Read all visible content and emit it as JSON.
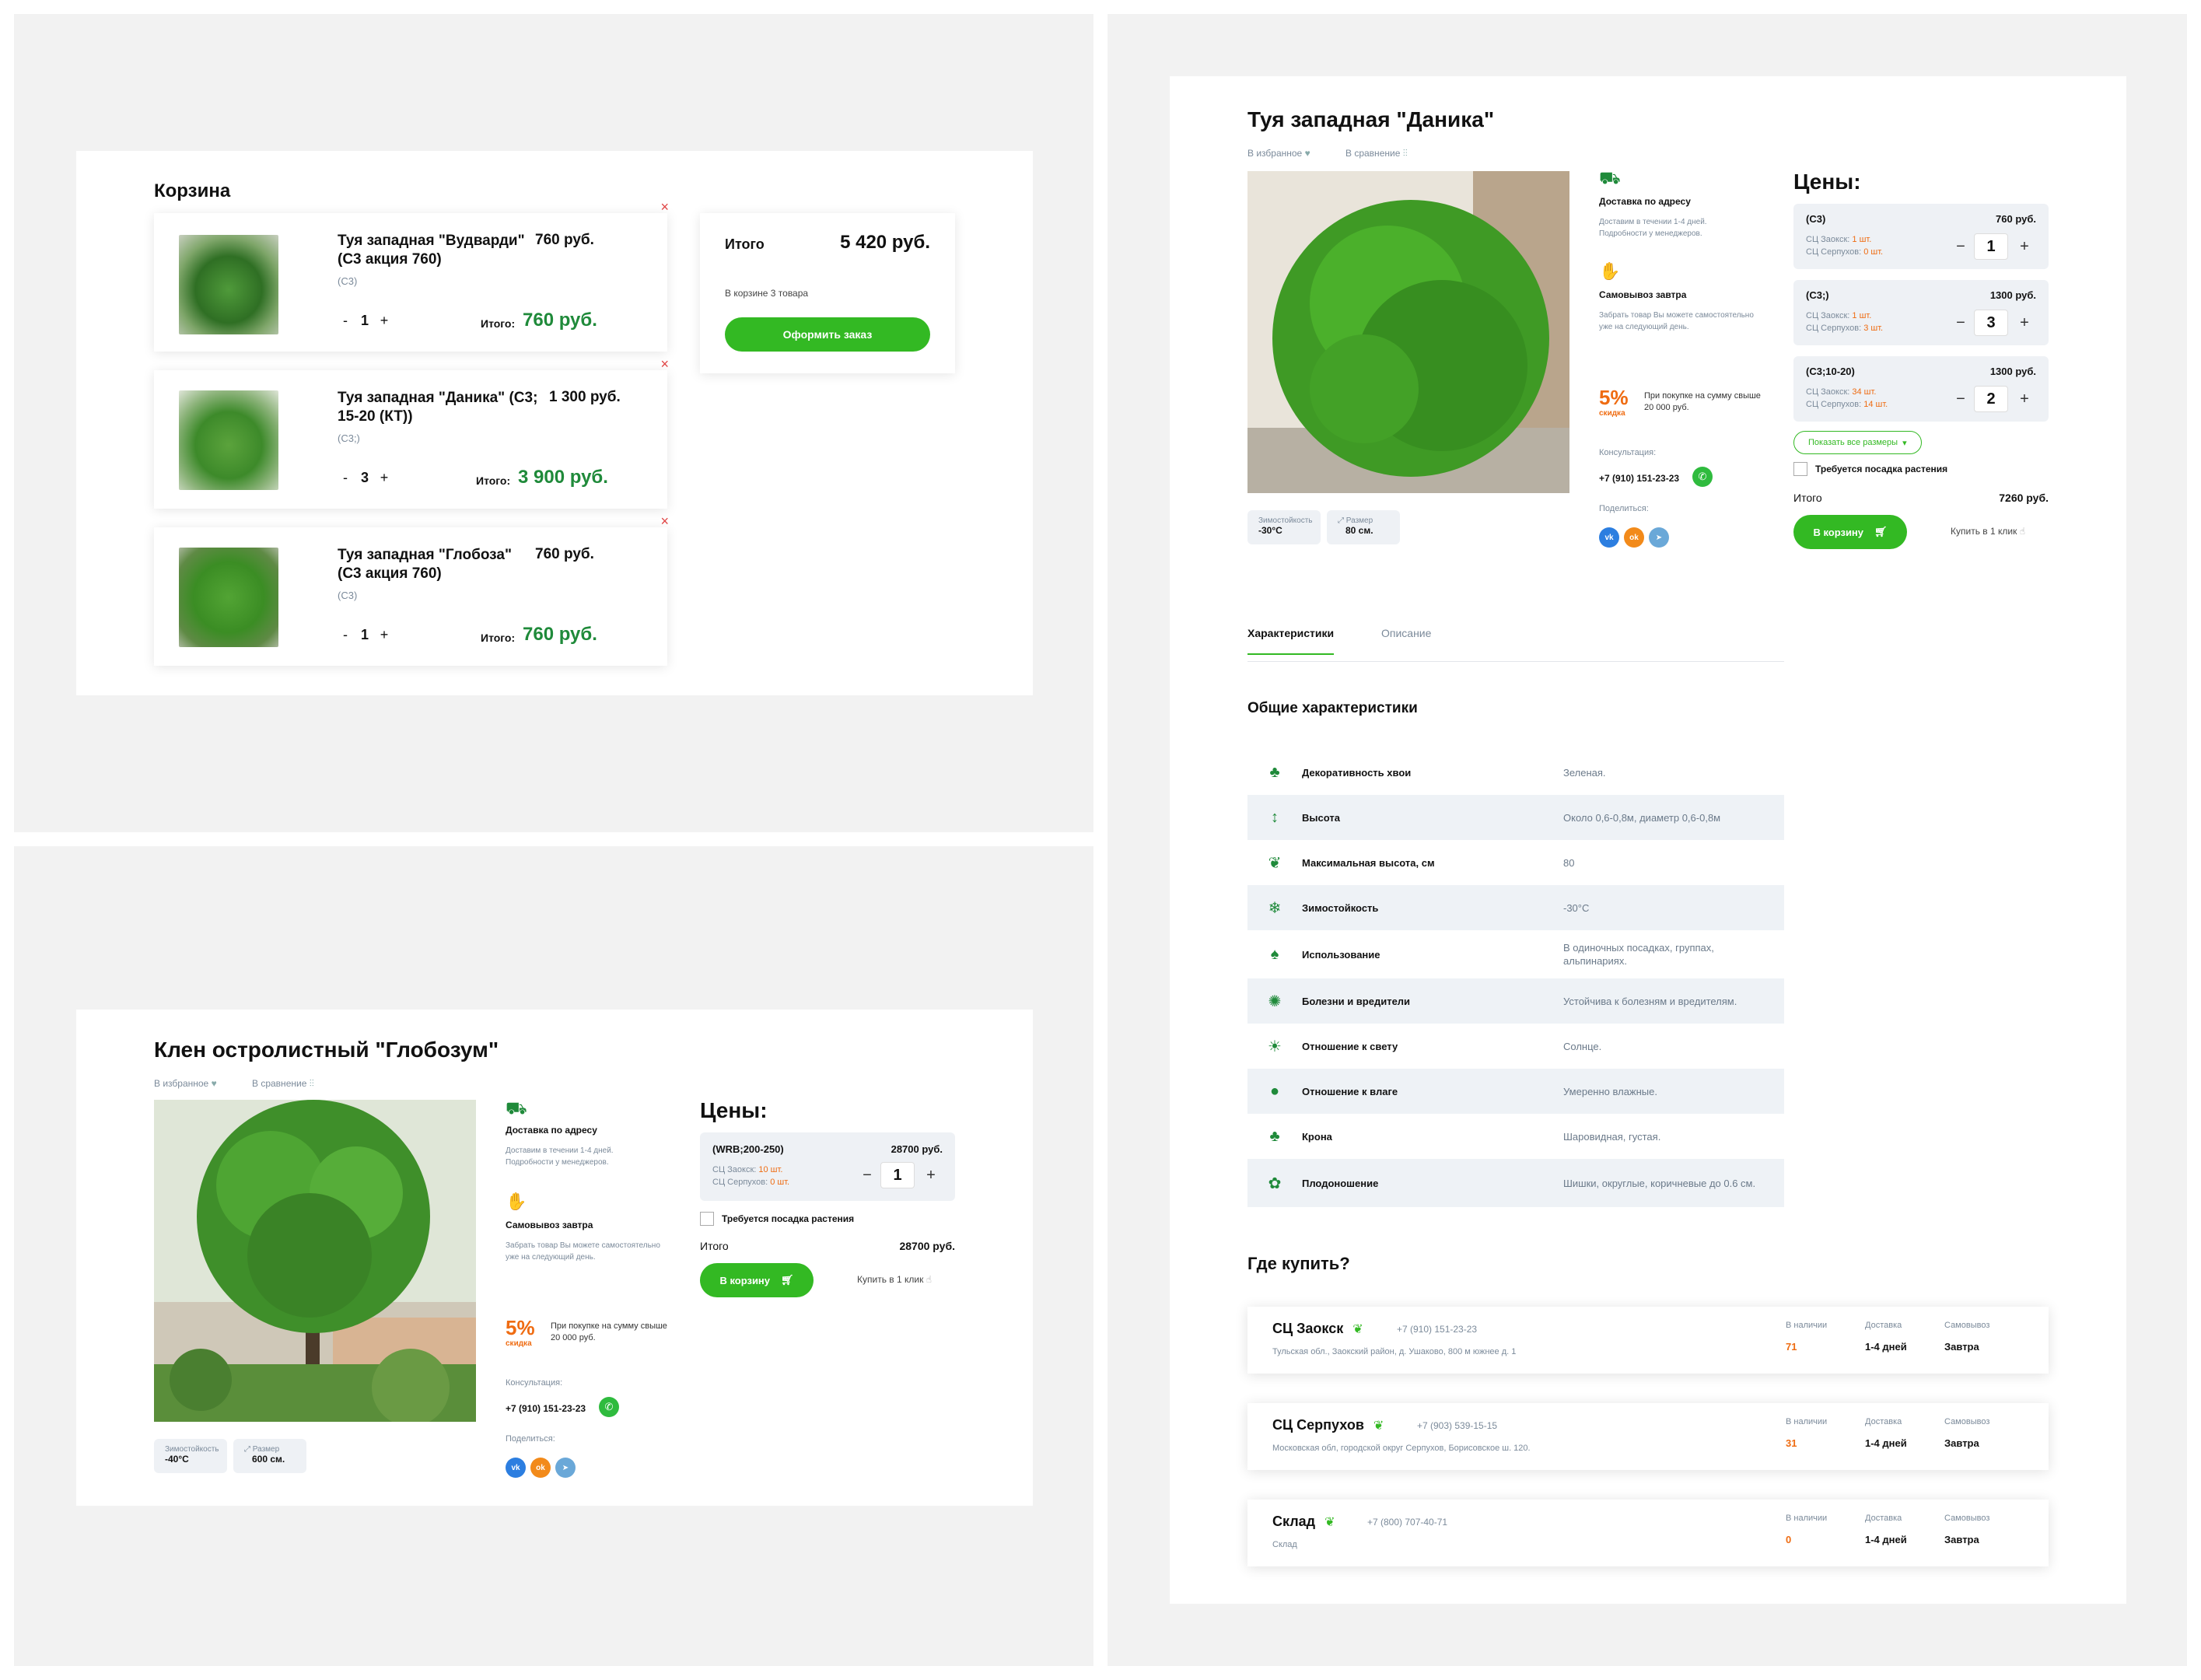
{
  "cart": {
    "title": "Корзина",
    "items": [
      {
        "name": "Туя западная \"Вудварди\" (С3 акция 760)",
        "size": "(С3)",
        "price": "760 руб.",
        "qty": "1",
        "total_label": "Итого:",
        "total": "760 руб."
      },
      {
        "name": "Туя западная \"Даника\" (С3; 15-20 (КТ))",
        "size": "(С3;)",
        "price": "1 300 руб.",
        "qty": "3",
        "total_label": "Итого:",
        "total": "3 900 руб."
      },
      {
        "name": "Туя западная \"Глобоза\" (С3 акция 760)",
        "size": "(С3)",
        "price": "760 руб.",
        "qty": "1",
        "total_label": "Итого:",
        "total": "760 руб."
      }
    ],
    "summary": {
      "label": "Итого",
      "total": "5 420 руб.",
      "count_text": "В корзине 3 товара",
      "checkout": "Оформить заказ"
    }
  },
  "product_klen": {
    "title": "Клен остролистный \"Глобозум\"",
    "favorites": "В избранное",
    "compare": "В сравнение",
    "delivery_title": "Доставка по адресу",
    "delivery_text": "Доставим в течении 1-4 дней. Подробности у менеджеров.",
    "pickup_title": "Самовывоз завтра",
    "pickup_text": "Забрать товар Вы можете самостоятельно уже на следующий день.",
    "discount_pct": "5%",
    "discount_word": "скидка",
    "discount_text": "При покупке на сумму свыше 20 000 руб.",
    "consult_label": "Консультация:",
    "phone": "+7 (910) 151-23-23",
    "share_label": "Поделиться:",
    "frost_label": "Зимостойкость",
    "frost_value": "-40°C",
    "size_label": "Размер",
    "size_value": "600 см.",
    "prices_title": "Цены:",
    "variant": {
      "name": "(WRB;200-250)",
      "price": "28700 руб.",
      "stock1_label": "СЦ Заокск:",
      "stock1": "10 шт.",
      "stock2_label": "СЦ Серпухов:",
      "stock2": "0 шт.",
      "qty": "1"
    },
    "planting": "Требуется посадка растения",
    "total_label": "Итого",
    "total": "28700 руб.",
    "to_cart": "В корзину",
    "one_click": "Купить в 1 клик"
  },
  "product_danika": {
    "title": "Туя западная \"Даника\"",
    "favorites": "В избранное",
    "compare": "В сравнение",
    "delivery_title": "Доставка по адресу",
    "delivery_text": "Доставим в течении 1-4 дней. Подробности у менеджеров.",
    "pickup_title": "Самовывоз завтра",
    "pickup_text": "Забрать товар Вы можете самостоятельно уже на следующий день.",
    "discount_pct": "5%",
    "discount_word": "скидка",
    "discount_text": "При покупке на сумму свыше 20 000 руб.",
    "consult_label": "Консультация:",
    "phone": "+7 (910) 151-23-23",
    "share_label": "Поделиться:",
    "frost_label": "Зимостойкость",
    "frost_value": "-30°C",
    "size_label": "Размер",
    "size_value": "80 см.",
    "prices_title": "Цены:",
    "variants": [
      {
        "name": "(С3)",
        "price": "760 руб.",
        "stock1_label": "СЦ Заокск:",
        "stock1": "1 шт.",
        "stock2_label": "СЦ Серпухов:",
        "stock2": "0 шт.",
        "qty": "1"
      },
      {
        "name": "(С3;)",
        "price": "1300 руб.",
        "stock1_label": "СЦ Заокск:",
        "stock1": "1 шт.",
        "stock2_label": "СЦ Серпухов:",
        "stock2": "3 шт.",
        "qty": "3"
      },
      {
        "name": "(С3;10-20)",
        "price": "1300 руб.",
        "stock1_label": "СЦ Заокск:",
        "stock1": "34 шт.",
        "stock2_label": "СЦ Серпухов:",
        "stock2": "14 шт.",
        "qty": "2"
      }
    ],
    "show_all": "Показать все размеры",
    "planting": "Требуется посадка растения",
    "total_label": "Итого",
    "total": "7260 руб.",
    "to_cart": "В корзину",
    "one_click": "Купить в 1 клик",
    "tabs": [
      "Характеристики",
      "Описание"
    ],
    "chars_title": "Общие характеристики",
    "chars": [
      {
        "icon": "tree-icon",
        "label": "Декоративность хвои",
        "value": "Зеленая."
      },
      {
        "icon": "height-icon",
        "label": "Высота",
        "value": "Около 0,6-0,8м, диаметр 0,6-0,8м"
      },
      {
        "icon": "leaf-icon",
        "label": "Максимальная высота, см",
        "value": "80"
      },
      {
        "icon": "snowflake-icon",
        "label": "Зимостойкость",
        "value": "-30°C"
      },
      {
        "icon": "pot-icon",
        "label": "Использование",
        "value": "В одиночных посадках, группах, альпинариях."
      },
      {
        "icon": "bug-icon",
        "label": "Болезни и вредители",
        "value": "Устойчива к болезням и вредителям."
      },
      {
        "icon": "sun-icon",
        "label": "Отношение к свету",
        "value": "Солнце."
      },
      {
        "icon": "drop-icon",
        "label": "Отношение к влаге",
        "value": "Умеренно влажные."
      },
      {
        "icon": "crown-icon",
        "label": "Крона",
        "value": "Шаровидная, густая."
      },
      {
        "icon": "cone-icon",
        "label": "Плодоношение",
        "value": "Шишки, округлые, коричневые до 0.6 см."
      }
    ],
    "where_title": "Где купить?",
    "stores": [
      {
        "name": "СЦ Заокск",
        "phone": "+7 (910) 151-23-23",
        "address": "Тульская обл., Заокский район, д. Ушаково, 800 м южнее д. 1",
        "stock_label": "В наличии",
        "stock": "71",
        "delivery_label": "Доставка",
        "delivery": "1-4 дней",
        "pickup_label": "Самовывоз",
        "pickup": "Завтра"
      },
      {
        "name": "СЦ Серпухов",
        "phone": "+7 (903) 539-15-15",
        "address": "Московская обл, городской округ Серпухов, Борисовское ш. 120.",
        "stock_label": "В наличии",
        "stock": "31",
        "delivery_label": "Доставка",
        "delivery": "1-4 дней",
        "pickup_label": "Самовывоз",
        "pickup": "Завтра"
      },
      {
        "name": "Склад",
        "phone": "+7 (800) 707-40-71",
        "address": "Склад",
        "stock_label": "В наличии",
        "stock": "0",
        "delivery_label": "Доставка",
        "delivery": "1-4 дней",
        "pickup_label": "Самовывоз",
        "pickup": "Завтра"
      }
    ]
  },
  "colors": {
    "accent": "#33b923",
    "dark_green": "#1f8a3a",
    "orange": "#ef6c12",
    "panel_bg": "#f2f2f2"
  }
}
